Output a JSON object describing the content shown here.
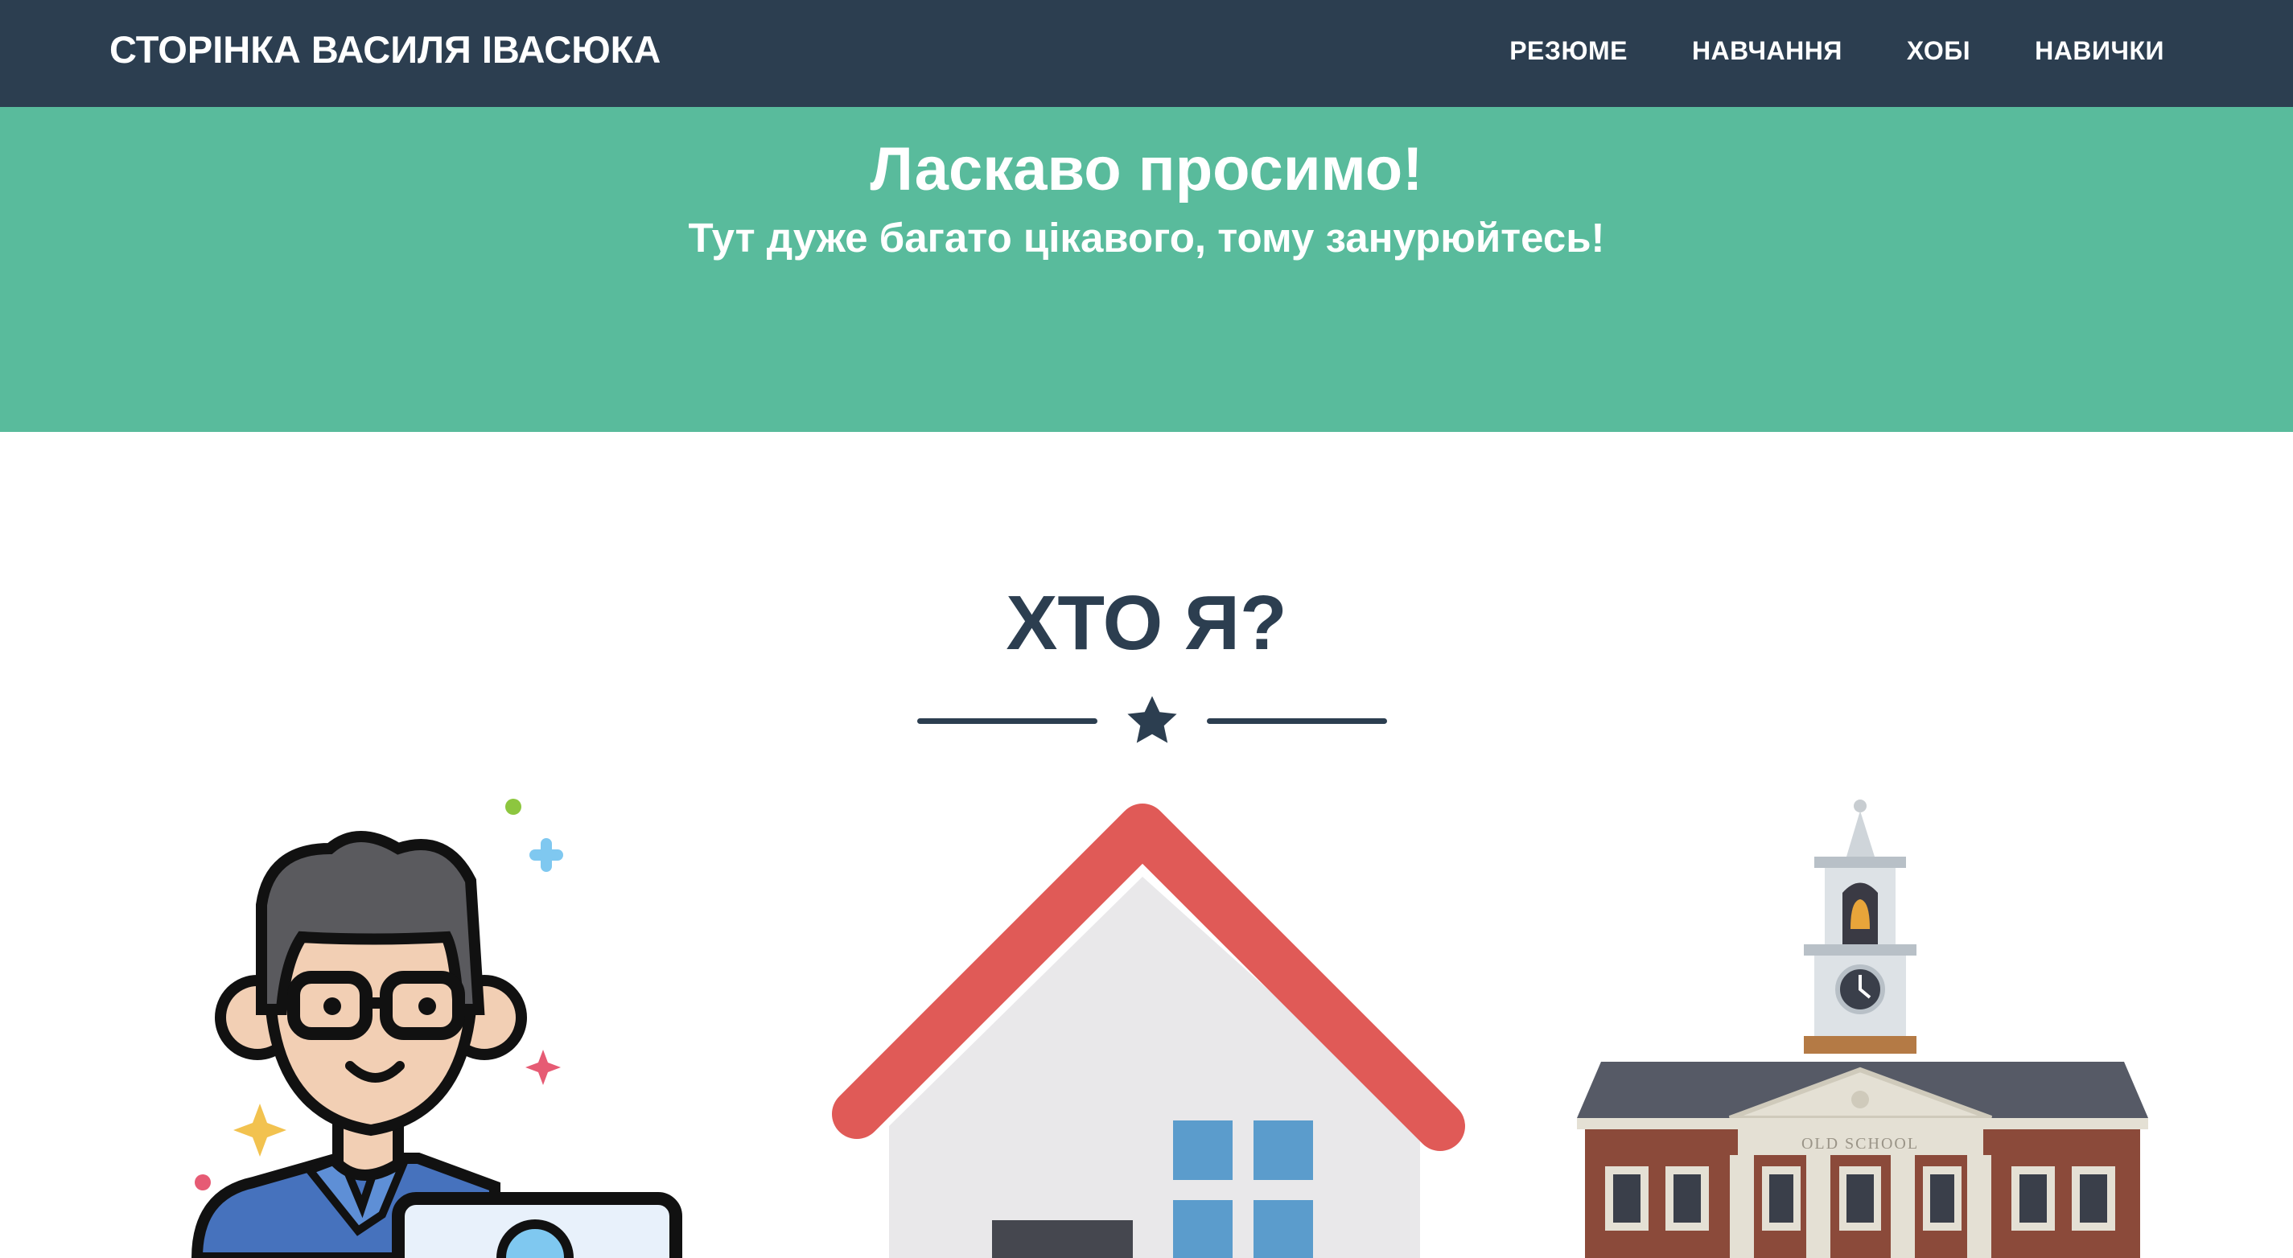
{
  "navbar": {
    "brand": "СТОРІНКА ВАСИЛЯ ІВАСЮКА",
    "items": [
      {
        "label": "РЕЗЮМЕ"
      },
      {
        "label": "НАВЧАННЯ"
      },
      {
        "label": "ХОБІ"
      },
      {
        "label": "НАВИЧКИ"
      }
    ]
  },
  "hero": {
    "title": "Ласкаво просимо!",
    "subtitle": "Тут дуже багато цікавого, тому занурюйтесь!"
  },
  "about": {
    "title": "ХТО Я?",
    "divider_icon": "star-icon"
  },
  "illustrations": {
    "school_sign": "OLD SCHOOL"
  },
  "colors": {
    "navbar": "#2c3e50",
    "hero": "#59bb9c",
    "heading": "#2c3e50",
    "roof": "#e05a57"
  }
}
